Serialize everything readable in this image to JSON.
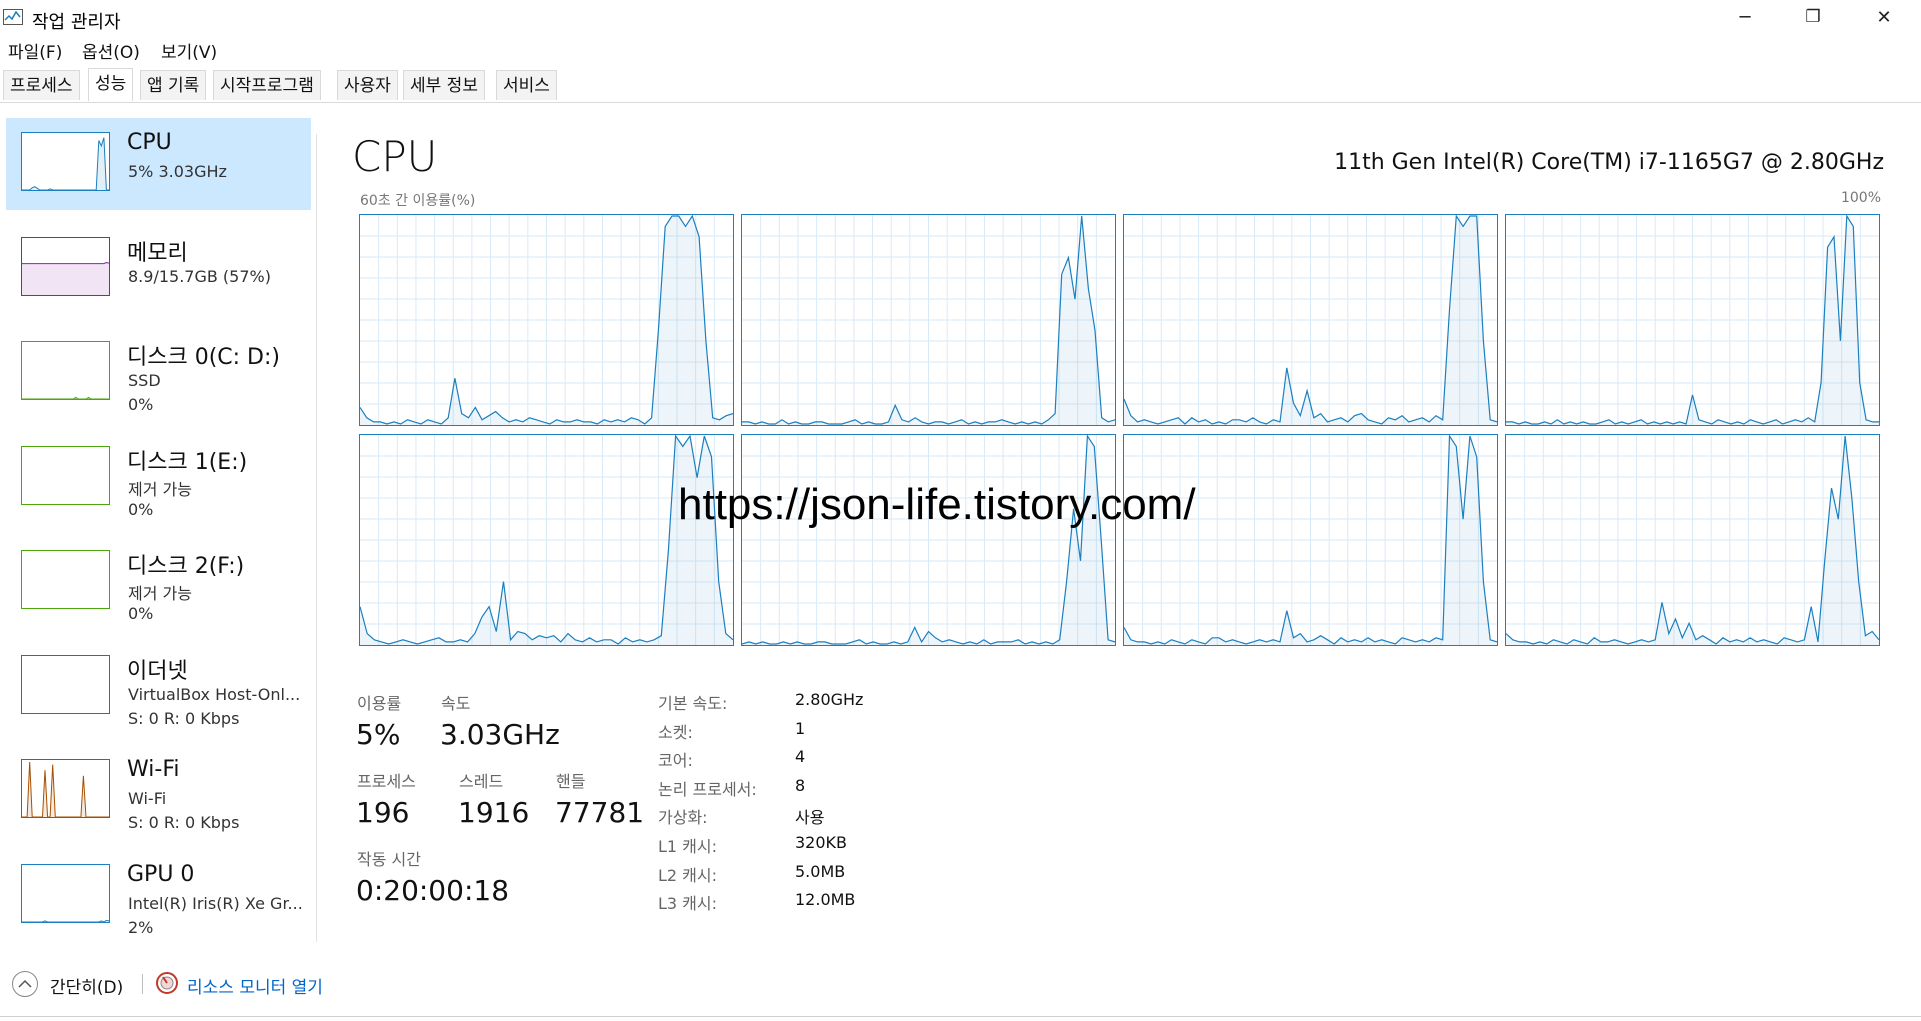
{
  "window": {
    "title": "작업 관리자",
    "minimize": "─",
    "maximize": "❐",
    "close": "✕"
  },
  "menu": [
    "파일(F)",
    "옵션(O)",
    "보기(V)"
  ],
  "tabs": [
    {
      "label": "프로세스"
    },
    {
      "label": "성능",
      "active": true
    },
    {
      "label": "앱 기록"
    },
    {
      "label": "시작프로그램"
    },
    {
      "label": "사용자"
    },
    {
      "label": "세부 정보"
    },
    {
      "label": "서비스"
    }
  ],
  "sidebar": [
    {
      "name": "CPU",
      "line1": "5% 3.03GHz",
      "line2": "",
      "color": "#1b7fc0",
      "selected": true,
      "spark": [
        0,
        0,
        0,
        0,
        4,
        6,
        3,
        0,
        0,
        0,
        0,
        2,
        0,
        0,
        0,
        0,
        0,
        0,
        0,
        0,
        0,
        0,
        0,
        0,
        0,
        0,
        0,
        0,
        0,
        0,
        90,
        80,
        95,
        0,
        0
      ]
    },
    {
      "name": "메모리",
      "line1": "8.9/15.7GB (57%)",
      "line2": "",
      "color": "#8b22a5",
      "selected": false,
      "spark": [
        57,
        57,
        57,
        57,
        57,
        57,
        57,
        57,
        57,
        57,
        57,
        57,
        57,
        57,
        57,
        57,
        57,
        57,
        57,
        57,
        57,
        57,
        57,
        57,
        57,
        57,
        57,
        57,
        57,
        57,
        57,
        57,
        57,
        59,
        58
      ]
    },
    {
      "name": "디스크 0(C: D:)",
      "line1": "SSD",
      "line2": "0%",
      "color": "#4da60c",
      "selected": false,
      "spark": [
        0,
        0,
        0,
        0,
        0,
        0,
        0,
        0,
        0,
        0,
        0,
        0,
        0,
        0,
        0,
        0,
        0,
        0,
        0,
        0,
        0,
        3,
        0,
        0,
        0,
        0,
        3,
        0,
        0,
        0,
        0,
        0,
        0,
        0,
        0
      ]
    },
    {
      "name": "디스크 1(E:)",
      "line1": "제거 가능",
      "line2": "0%",
      "color": "#4da60c",
      "selected": false,
      "spark": []
    },
    {
      "name": "디스크 2(F:)",
      "line1": "제거 가능",
      "line2": "0%",
      "color": "#4da60c",
      "selected": false,
      "spark": []
    },
    {
      "name": "이더넷",
      "line1": "VirtualBox Host-Onl...",
      "line2": "S: 0  R: 0 Kbps",
      "color": "#a74f01",
      "selected": false,
      "spark": []
    },
    {
      "name": "Wi-Fi",
      "line1": "Wi-Fi",
      "line2": "S: 0  R: 0 Kbps",
      "color": "#a74f01",
      "selected": false,
      "spark": [
        0,
        0,
        0,
        100,
        0,
        0,
        0,
        0,
        0,
        85,
        0,
        0,
        95,
        0,
        0,
        0,
        0,
        0,
        0,
        0,
        0,
        0,
        0,
        0,
        75,
        0,
        0,
        0,
        0,
        0,
        0,
        0,
        0,
        0,
        0
      ]
    },
    {
      "name": "GPU 0",
      "line1": "Intel(R) Iris(R) Xe Gr...",
      "line2": "2%",
      "color": "#1b7fc0",
      "selected": false,
      "spark": [
        0,
        0,
        0,
        0,
        0,
        0,
        0,
        0,
        0,
        2,
        0,
        0,
        0,
        0,
        0,
        0,
        0,
        0,
        0,
        0,
        0,
        0,
        0,
        0,
        0,
        0,
        0,
        0,
        0,
        0,
        0,
        2,
        0,
        3,
        2
      ]
    }
  ],
  "main": {
    "title": "CPU",
    "model": "11th Gen Intel(R) Core(TM) i7-1165G7 @ 2.80GHz",
    "graph_label": "60초 간 이용률(%)",
    "graph_max": "100%",
    "accent": "#1b7fc0",
    "cores": [
      [
        8,
        3,
        1,
        1,
        0,
        1,
        0,
        2,
        1,
        0,
        2,
        1,
        0,
        3,
        22,
        5,
        3,
        8,
        2,
        4,
        6,
        3,
        1,
        2,
        1,
        3,
        2,
        1,
        0,
        2,
        1,
        1,
        2,
        1,
        1,
        0,
        2,
        1,
        2,
        1,
        3,
        2,
        0,
        3,
        45,
        95,
        100,
        100,
        95,
        100,
        90,
        40,
        3,
        2,
        4,
        5
      ],
      [
        1,
        1,
        0,
        1,
        0,
        0,
        2,
        0,
        1,
        0,
        0,
        1,
        1,
        0,
        0,
        0,
        1,
        2,
        0,
        1,
        0,
        0,
        1,
        9,
        2,
        1,
        3,
        1,
        0,
        1,
        1,
        0,
        1,
        2,
        0,
        1,
        0,
        1,
        1,
        2,
        1,
        0,
        1,
        0,
        1,
        0,
        2,
        5,
        72,
        80,
        60,
        100,
        65,
        45,
        3,
        1,
        2
      ],
      [
        12,
        4,
        1,
        2,
        1,
        0,
        1,
        2,
        3,
        0,
        3,
        1,
        2,
        0,
        1,
        0,
        2,
        2,
        1,
        3,
        1,
        0,
        2,
        1,
        27,
        10,
        4,
        16,
        3,
        5,
        1,
        2,
        3,
        1,
        4,
        5,
        2,
        1,
        0,
        3,
        2,
        4,
        1,
        2,
        3,
        1,
        4,
        2,
        55,
        100,
        95,
        100,
        100,
        40,
        2,
        1
      ],
      [
        1,
        1,
        0,
        1,
        0,
        0,
        1,
        0,
        2,
        0,
        1,
        0,
        1,
        0,
        0,
        1,
        2,
        0,
        1,
        0,
        1,
        2,
        0,
        1,
        0,
        1,
        0,
        1,
        0,
        14,
        2,
        1,
        0,
        2,
        1,
        0,
        1,
        0,
        2,
        1,
        0,
        1,
        2,
        0,
        1,
        2,
        1,
        3,
        1,
        20,
        85,
        90,
        40,
        100,
        95,
        20,
        2,
        1,
        1
      ],
      [
        18,
        5,
        2,
        1,
        0,
        1,
        2,
        1,
        0,
        1,
        2,
        3,
        1,
        1,
        2,
        1,
        5,
        13,
        18,
        6,
        30,
        2,
        6,
        5,
        2,
        4,
        3,
        4,
        1,
        5,
        2,
        1,
        3,
        1,
        2,
        2,
        0,
        3,
        1,
        2,
        1,
        2,
        4,
        45,
        100,
        95,
        100,
        80,
        100,
        90,
        30,
        5,
        2
      ],
      [
        0,
        1,
        0,
        1,
        0,
        0,
        1,
        0,
        1,
        0,
        0,
        1,
        1,
        0,
        0,
        0,
        1,
        2,
        0,
        1,
        0,
        0,
        1,
        0,
        1,
        8,
        1,
        6,
        3,
        1,
        2,
        1,
        0,
        1,
        0,
        2,
        0,
        1,
        1,
        1,
        2,
        0,
        1,
        0,
        1,
        0,
        2,
        30,
        65,
        40,
        100,
        95,
        50,
        2,
        1
      ],
      [
        8,
        2,
        1,
        1,
        0,
        1,
        0,
        2,
        1,
        0,
        2,
        1,
        0,
        3,
        3,
        1,
        2,
        1,
        0,
        1,
        2,
        1,
        2,
        1,
        16,
        3,
        5,
        1,
        2,
        4,
        2,
        0,
        3,
        1,
        2,
        1,
        3,
        1,
        2,
        1,
        0,
        3,
        2,
        1,
        2,
        1,
        3,
        2,
        100,
        95,
        60,
        100,
        90,
        30,
        2,
        1
      ],
      [
        5,
        2,
        1,
        1,
        0,
        1,
        0,
        2,
        1,
        0,
        2,
        1,
        0,
        3,
        1,
        1,
        2,
        1,
        0,
        1,
        2,
        1,
        2,
        20,
        5,
        12,
        3,
        10,
        2,
        4,
        2,
        0,
        3,
        1,
        2,
        1,
        3,
        1,
        2,
        1,
        0,
        3,
        2,
        1,
        2,
        18,
        1,
        40,
        75,
        60,
        100,
        70,
        30,
        4,
        6,
        2
      ]
    ]
  },
  "stats": {
    "util_label": "이용률",
    "util_value": "5%",
    "speed_label": "속도",
    "speed_value": "3.03GHz",
    "proc_label": "프로세스",
    "proc_value": "196",
    "thread_label": "스레드",
    "thread_value": "1916",
    "handle_label": "핸들",
    "handle_value": "77781",
    "uptime_label": "작동 시간",
    "uptime_value": "0:20:00:18"
  },
  "specs": [
    {
      "key": "기본 속도:",
      "value": "2.80GHz"
    },
    {
      "key": "소켓:",
      "value": "1"
    },
    {
      "key": "코어:",
      "value": "4"
    },
    {
      "key": "논리 프로세서:",
      "value": "8"
    },
    {
      "key": "가상화:",
      "value": "사용"
    },
    {
      "key": "L1 캐시:",
      "value": "320KB"
    },
    {
      "key": "L2 캐시:",
      "value": "5.0MB"
    },
    {
      "key": "L3 캐시:",
      "value": "12.0MB"
    }
  ],
  "watermark": "https://json-life.tistory.com/",
  "footer": {
    "collapse": "간단히(D)",
    "resmon": "리소스 모니터 열기"
  }
}
